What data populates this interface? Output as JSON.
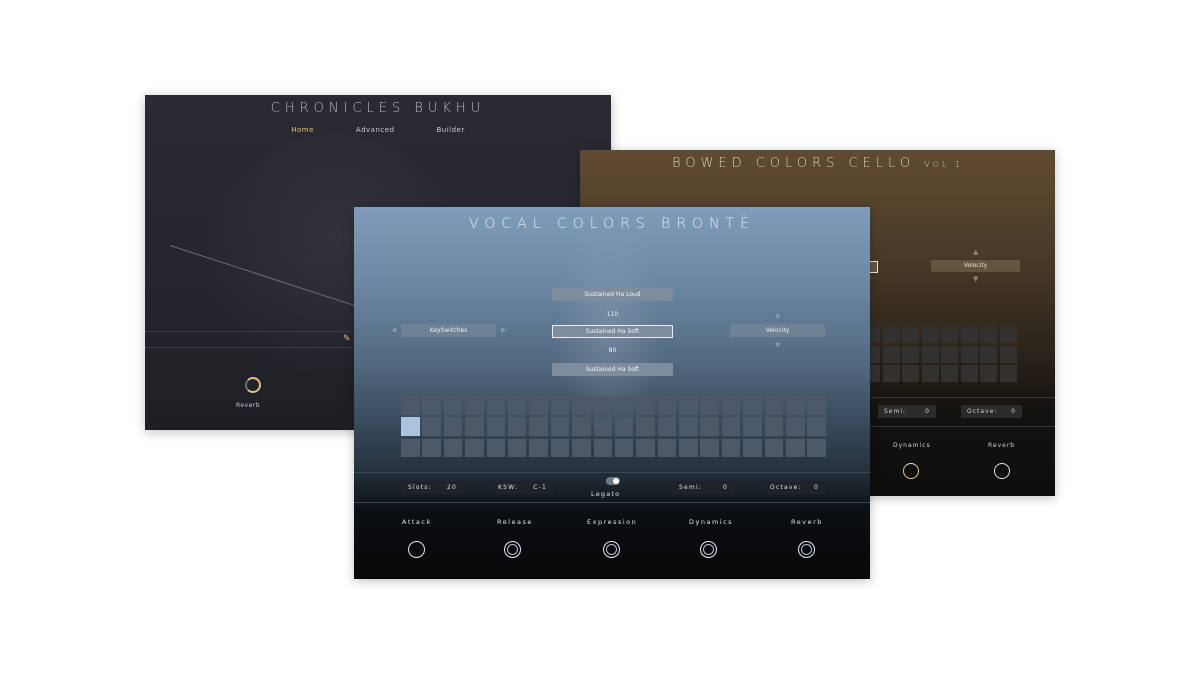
{
  "chronicles_bukhu": {
    "title": "CHRONICLES BUKHU",
    "tabs": [
      "Home",
      "Advanced",
      "Builder"
    ],
    "active_tab": "Home",
    "knob_label": "Reverb"
  },
  "bowed_colors_cello": {
    "title": "BOWED COLORS CELLO",
    "subtitle": "VOL 1",
    "velocity_label": "Velocity",
    "fields": [
      {
        "label": "Semi:",
        "value": "0"
      },
      {
        "label": "Octave:",
        "value": "0"
      }
    ],
    "knobs": [
      "Dynamics",
      "Reverb"
    ]
  },
  "vocal_colors_bronte": {
    "title": "VOCAL COLORS BRONTË",
    "articulations": [
      "Sustained Ha Loud",
      "Sustained Ha Soft",
      "Sustained Ha Soft"
    ],
    "upper_value": "110",
    "lower_value": "80",
    "keyswitches_label": "KeySwitches",
    "velocity_label": "Velocity",
    "fields": [
      {
        "label": "Slots:",
        "value": "20"
      },
      {
        "label": "KSW:",
        "value": "C-1"
      },
      {
        "label": "Semi:",
        "value": "0"
      },
      {
        "label": "Octave:",
        "value": "0"
      }
    ],
    "legato_label": "Legato",
    "knobs": [
      "Attack",
      "Release",
      "Expression",
      "Dynamics",
      "Reverb"
    ]
  },
  "colors": {
    "accent_gold": "#e0c281",
    "selected_slot": "#a9c4dc"
  }
}
